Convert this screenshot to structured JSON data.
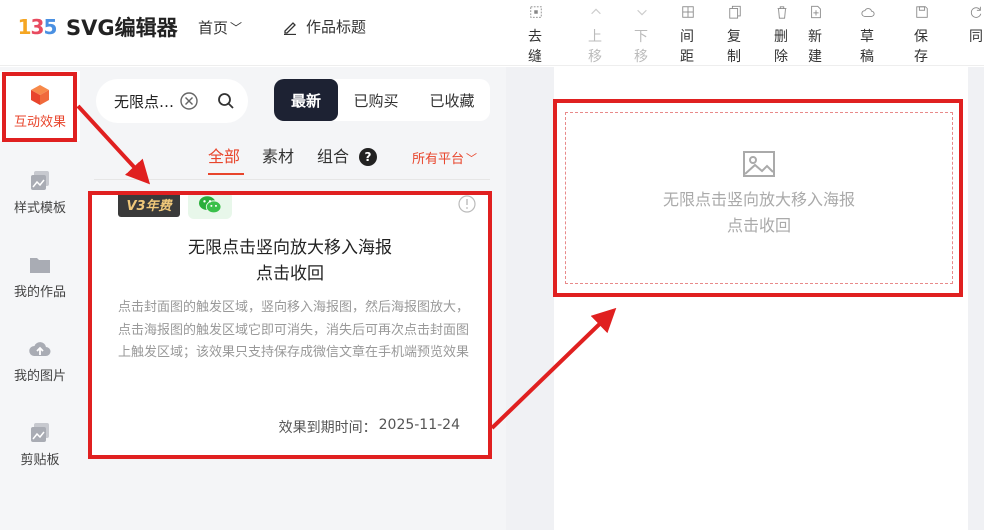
{
  "app": {
    "logo_text": "135",
    "name": "SVG编辑器"
  },
  "nav": {
    "home_label": "首页",
    "title_label": "作品标题"
  },
  "toolbar": {
    "items": [
      {
        "label": "去缝隙",
        "icon": "gap-icon",
        "enabled": true
      },
      {
        "label": "上移",
        "icon": "arrow-up-icon",
        "enabled": false
      },
      {
        "label": "下移",
        "icon": "arrow-down-icon",
        "enabled": false
      },
      {
        "label": "间距",
        "icon": "spacing-icon",
        "enabled": true
      },
      {
        "label": "复制",
        "icon": "copy-icon",
        "enabled": true
      },
      {
        "label": "删除",
        "icon": "trash-icon",
        "enabled": true
      },
      {
        "label": "新建",
        "icon": "new-file-icon",
        "enabled": true
      },
      {
        "label": "草稿",
        "icon": "cloud-icon",
        "enabled": true
      },
      {
        "label": "保存",
        "icon": "save-icon",
        "enabled": true
      },
      {
        "label": "同",
        "icon": "sync-icon",
        "enabled": true
      }
    ]
  },
  "rail": {
    "items": [
      {
        "label": "互动效果",
        "icon": "cube-icon",
        "active": true
      },
      {
        "label": "样式模板",
        "icon": "template-icon",
        "active": false
      },
      {
        "label": "我的作品",
        "icon": "folder-icon",
        "active": false
      },
      {
        "label": "我的图片",
        "icon": "cloud-upload-icon",
        "active": false
      },
      {
        "label": "剪贴板",
        "icon": "clipboard-icon",
        "active": false
      }
    ]
  },
  "search": {
    "value": "无限点击竖向放大移入海报"
  },
  "filter_tabs": [
    {
      "label": "最新",
      "active": true
    },
    {
      "label": "已购买",
      "active": false
    },
    {
      "label": "已收藏",
      "active": false
    }
  ],
  "categories": [
    {
      "label": "全部",
      "active": true
    },
    {
      "label": "素材",
      "active": false
    },
    {
      "label": "组合",
      "active": false
    }
  ],
  "help_glyph": "?",
  "platform_label": "所有平台",
  "card": {
    "badge_v3": "V3年费",
    "title_line1": "无限点击竖向放大移入海报",
    "title_line2": "点击收回",
    "description": "点击封面图的触发区域，竖向移入海报图，然后海报图放大，点击海报图的触发区域它即可消失，消失后可再次点击封面图上触发区域；该效果只支持保存成微信文章在手机端预览效果",
    "expire_label": "效果到期时间：",
    "expire_date": "2025-11-24"
  },
  "canvas": {
    "placeholder_line1": "无限点击竖向放大移入海报",
    "placeholder_line2": "点击收回"
  },
  "colors": {
    "accent": "#e8452c",
    "highlight": "#e02020",
    "dark_tab": "#1d2233"
  }
}
